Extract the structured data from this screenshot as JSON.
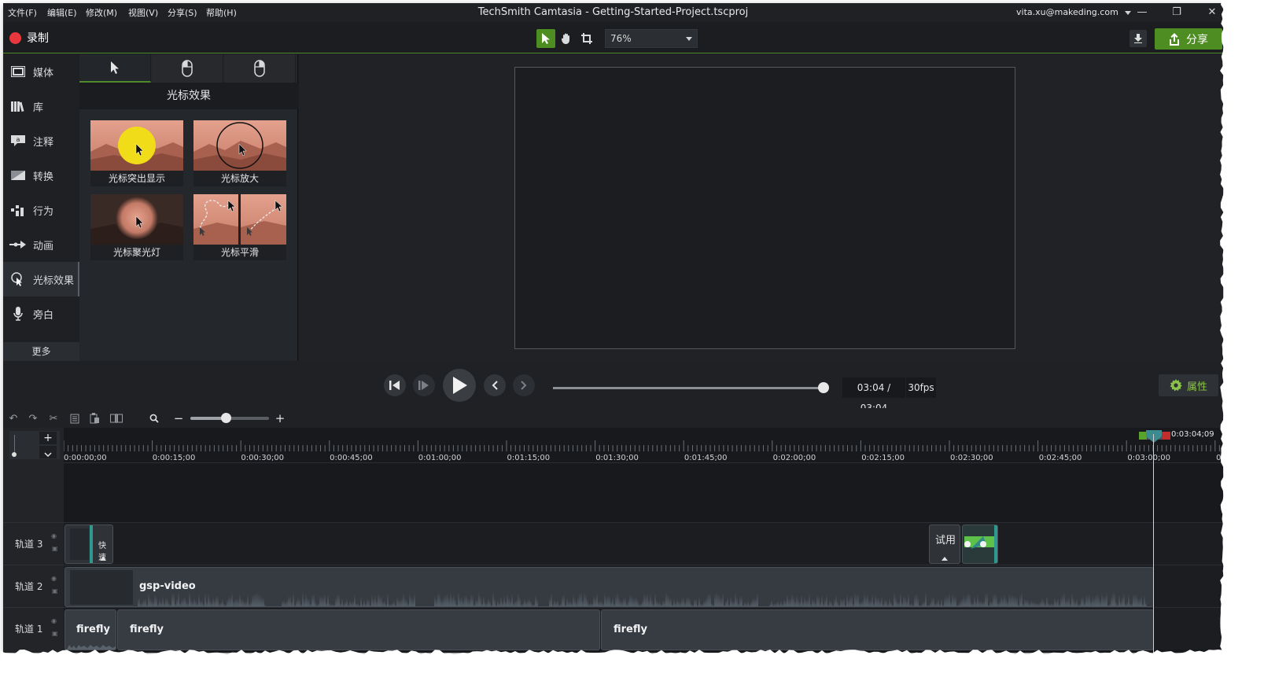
{
  "titlebar": {
    "menus": [
      "文件(F)",
      "编辑(E)",
      "修改(M)",
      "视图(V)",
      "分享(S)",
      "帮助(H)"
    ],
    "title": "TechSmith Camtasia - Getting-Started-Project.tscproj",
    "account": "vita.xu@makeding.com",
    "window_controls": [
      "minimize-icon",
      "restore-icon",
      "close-icon"
    ]
  },
  "toolbar": {
    "record_label": "录制",
    "zoom_value": "76%",
    "share_label": "分享",
    "accent_color": "#4e8d22",
    "record_color": "#e8383d"
  },
  "sidebar": {
    "items": [
      {
        "label": "媒体",
        "icon": "film-icon"
      },
      {
        "label": "库",
        "icon": "library-icon"
      },
      {
        "label": "注释",
        "icon": "annotation-icon"
      },
      {
        "label": "转换",
        "icon": "transition-icon"
      },
      {
        "label": "行为",
        "icon": "behavior-icon"
      },
      {
        "label": "动画",
        "icon": "animation-arrow-icon"
      },
      {
        "label": "光标效果",
        "icon": "cursor-effect-icon"
      },
      {
        "label": "旁白",
        "icon": "microphone-icon"
      }
    ],
    "active_index": 6,
    "more_label": "更多"
  },
  "panel": {
    "tabs": [
      "cursor-tab-icon",
      "left-click-tab-icon",
      "right-click-tab-icon"
    ],
    "title": "光标效果",
    "effects": [
      {
        "label": "光标突出显示"
      },
      {
        "label": "光标放大"
      },
      {
        "label": "光标聚光灯"
      },
      {
        "label": "光标平滑"
      }
    ]
  },
  "playback": {
    "timecode": "03:04 / 03:04",
    "fps": "30fps",
    "progress": 1.0,
    "properties_label": "属性"
  },
  "timeline": {
    "zoom_level": 0.45,
    "ruler_labels": [
      "0:00:00;00",
      "0:00:15;00",
      "0:00:30;00",
      "0:00:45;00",
      "0:01:00;00",
      "0:01:15;00",
      "0:01:30;00",
      "0:01:45;00",
      "0:02:00;00",
      "0:02:15;00",
      "0:02:30;00",
      "0:02:45;00",
      "0:03:00;00",
      "0:"
    ],
    "playhead_time": "0:03:04;09",
    "tracks": [
      {
        "name": "轨道 3"
      },
      {
        "name": "轨道 2"
      },
      {
        "name": "轨道 1"
      }
    ],
    "clips": {
      "track3_quick": "快速",
      "track3_trial": "试用",
      "track2_video": "gsp-video",
      "track1_a": "firefly",
      "track1_b": "firefly",
      "track1_c": "firefly"
    }
  }
}
